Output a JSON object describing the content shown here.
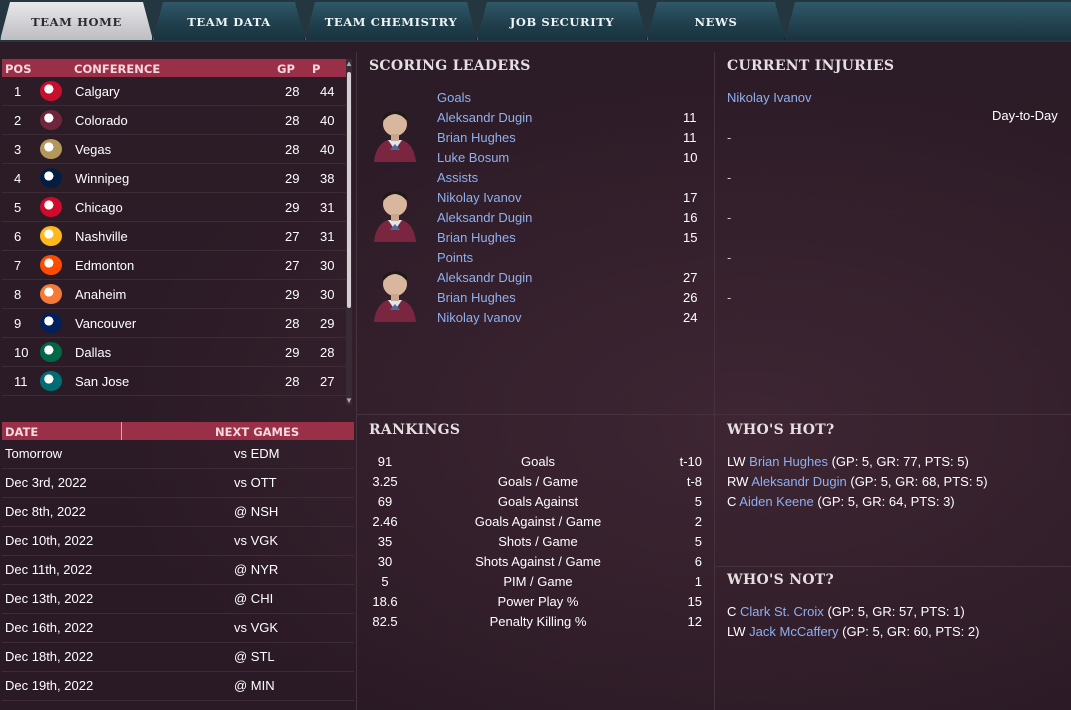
{
  "tabs": [
    "TEAM HOME",
    "TEAM DATA",
    "TEAM CHEMISTRY",
    "JOB SECURITY",
    "NEWS"
  ],
  "standings": {
    "headers": {
      "pos": "POS",
      "conference": "CONFERENCE",
      "gp": "GP",
      "p": "P"
    },
    "rows": [
      {
        "pos": "1",
        "team": "Calgary",
        "gp": "28",
        "p": "44",
        "color": "#c8102e"
      },
      {
        "pos": "2",
        "team": "Colorado",
        "gp": "28",
        "p": "40",
        "color": "#6f263d"
      },
      {
        "pos": "3",
        "team": "Vegas",
        "gp": "28",
        "p": "40",
        "color": "#b4975a"
      },
      {
        "pos": "4",
        "team": "Winnipeg",
        "gp": "29",
        "p": "38",
        "color": "#041e42"
      },
      {
        "pos": "5",
        "team": "Chicago",
        "gp": "29",
        "p": "31",
        "color": "#cf0a2c"
      },
      {
        "pos": "6",
        "team": "Nashville",
        "gp": "27",
        "p": "31",
        "color": "#ffb81c"
      },
      {
        "pos": "7",
        "team": "Edmonton",
        "gp": "27",
        "p": "30",
        "color": "#ff4c00"
      },
      {
        "pos": "8",
        "team": "Anaheim",
        "gp": "29",
        "p": "30",
        "color": "#f47a38"
      },
      {
        "pos": "9",
        "team": "Vancouver",
        "gp": "28",
        "p": "29",
        "color": "#00205b"
      },
      {
        "pos": "10",
        "team": "Dallas",
        "gp": "29",
        "p": "28",
        "color": "#006847"
      },
      {
        "pos": "11",
        "team": "San Jose",
        "gp": "28",
        "p": "27",
        "color": "#006d75"
      }
    ]
  },
  "games": {
    "headers": {
      "date": "DATE",
      "next": "NEXT GAMES"
    },
    "rows": [
      {
        "date": "Tomorrow",
        "opp": "vs EDM"
      },
      {
        "date": "Dec 3rd, 2022",
        "opp": "vs OTT"
      },
      {
        "date": "Dec 8th, 2022",
        "opp": "@ NSH"
      },
      {
        "date": "Dec 10th, 2022",
        "opp": "vs VGK"
      },
      {
        "date": "Dec 11th, 2022",
        "opp": "@ NYR"
      },
      {
        "date": "Dec 13th, 2022",
        "opp": "@ CHI"
      },
      {
        "date": "Dec 16th, 2022",
        "opp": "vs VGK"
      },
      {
        "date": "Dec 18th, 2022",
        "opp": "@ STL"
      },
      {
        "date": "Dec 19th, 2022",
        "opp": "@ MIN"
      }
    ]
  },
  "scoring": {
    "title": "SCORING LEADERS",
    "groups": [
      {
        "label": "Goals",
        "players": [
          {
            "name": "Aleksandr Dugin",
            "val": "11"
          },
          {
            "name": "Brian Hughes",
            "val": "11"
          },
          {
            "name": "Luke Bosum",
            "val": "10"
          }
        ]
      },
      {
        "label": "Assists",
        "players": [
          {
            "name": "Nikolay Ivanov",
            "val": "17"
          },
          {
            "name": "Aleksandr Dugin",
            "val": "16"
          },
          {
            "name": "Brian Hughes",
            "val": "15"
          }
        ]
      },
      {
        "label": "Points",
        "players": [
          {
            "name": "Aleksandr Dugin",
            "val": "27"
          },
          {
            "name": "Brian Hughes",
            "val": "26"
          },
          {
            "name": "Nikolay Ivanov",
            "val": "24"
          }
        ]
      }
    ]
  },
  "injuries": {
    "title": "CURRENT INJURIES",
    "player": "Nikolay Ivanov",
    "status": "Day-to-Day",
    "dashes": [
      "-",
      "-",
      "-",
      "-",
      "-"
    ]
  },
  "rankings": {
    "title": "RANKINGS",
    "rows": [
      {
        "value": "91",
        "stat": "Goals",
        "rank": "t-10"
      },
      {
        "value": "3.25",
        "stat": "Goals / Game",
        "rank": "t-8"
      },
      {
        "value": "69",
        "stat": "Goals Against",
        "rank": "5"
      },
      {
        "value": "2.46",
        "stat": "Goals Against / Game",
        "rank": "2"
      },
      {
        "value": "35",
        "stat": "Shots / Game",
        "rank": "5"
      },
      {
        "value": "30",
        "stat": "Shots Against / Game",
        "rank": "6"
      },
      {
        "value": "5",
        "stat": "PIM / Game",
        "rank": "1"
      },
      {
        "value": "18.6",
        "stat": "Power Play %",
        "rank": "15"
      },
      {
        "value": "82.5",
        "stat": "Penalty Killing %",
        "rank": "12"
      }
    ]
  },
  "hot": {
    "title": "WHO'S HOT?",
    "rows": [
      {
        "pos": "LW",
        "name": "Brian Hughes",
        "stats": "(GP: 5, GR: 77, PTS: 5)"
      },
      {
        "pos": "RW",
        "name": "Aleksandr Dugin",
        "stats": "(GP: 5, GR: 68, PTS: 5)"
      },
      {
        "pos": "C",
        "name": "Aiden Keene",
        "stats": "(GP: 5, GR: 64, PTS: 3)"
      }
    ]
  },
  "not": {
    "title": "WHO'S NOT?",
    "rows": [
      {
        "pos": "C",
        "name": "Clark St. Croix",
        "stats": "(GP: 5, GR: 57, PTS: 1)"
      },
      {
        "pos": "LW",
        "name": "Jack McCaffery",
        "stats": "(GP: 5, GR: 60, PTS: 2)"
      }
    ]
  }
}
